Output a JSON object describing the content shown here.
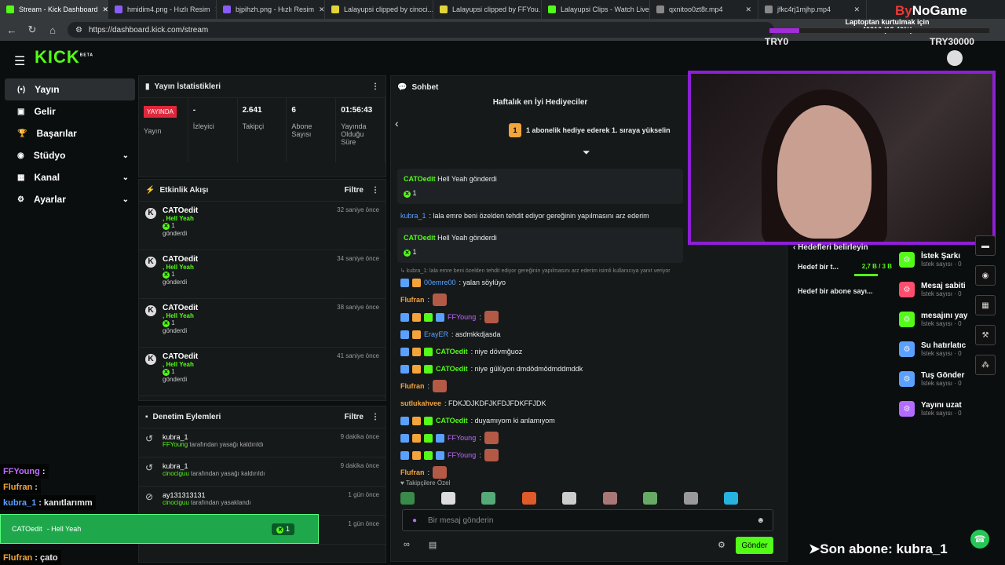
{
  "browser": {
    "tabs": [
      {
        "label": "Stream - Kick Dashboard",
        "color": "#53fc18"
      },
      {
        "label": "hmidim4.png - Hızlı Resim",
        "color": "#8a5cf6"
      },
      {
        "label": "bjpihzh.png - Hızlı Resim",
        "color": "#8a5cf6"
      },
      {
        "label": "Lalayupsi clipped by cinoci...",
        "color": "#e3d33a"
      },
      {
        "label": "Lalayupsi clipped by FFYou...",
        "color": "#e3d33a"
      },
      {
        "label": "Lalayupsi Clips - Watch Live...",
        "color": "#53fc18"
      },
      {
        "label": "qxnitoo0zt8r.mp4",
        "color": "#888888"
      },
      {
        "label": "jfkc4rj1mjhp.mp4",
        "color": "#888888"
      }
    ],
    "url": "https://dashboard.kick.com/stream"
  },
  "overlay": {
    "brand_a": "By",
    "brand_b": "NoGame",
    "goal_label": "Laptoptan kurtulmak için",
    "goal_value": "40216 (13.40%)",
    "goal_fraction": 0.134,
    "left_amount": "TRY0",
    "right_amount": "TRY30000",
    "son_abone": "➤Son abone: kubra_1"
  },
  "app": {
    "logo": "KICK",
    "logo_sup": "BETA"
  },
  "sidebar": {
    "items": [
      {
        "label": "Yayın",
        "icon": "(•)",
        "active": true,
        "chev": ""
      },
      {
        "label": "Gelir",
        "icon": "▣",
        "active": false,
        "chev": ""
      },
      {
        "label": "Başarılar",
        "icon": "🏆",
        "active": false,
        "chev": ""
      },
      {
        "label": "Stüdyo",
        "icon": "◉",
        "active": false,
        "chev": "⌄"
      },
      {
        "label": "Kanal",
        "icon": "▦",
        "active": false,
        "chev": "⌄"
      },
      {
        "label": "Ayarlar",
        "icon": "⚙",
        "active": false,
        "chev": "⌄"
      }
    ]
  },
  "stats": {
    "title": "Yayın İstatistikleri",
    "live": "YAYINDA",
    "items": [
      {
        "value": "",
        "label": "Yayın"
      },
      {
        "value": "-",
        "label": "İzleyici"
      },
      {
        "value": "2.641",
        "label": "Takipçi"
      },
      {
        "value": "6",
        "label": "Abone Sayısı"
      },
      {
        "value": "01:56:43",
        "label": "Yayında Olduğu Süre"
      }
    ]
  },
  "events": {
    "title": "Etkinlik Akışı",
    "filter": "Filtre",
    "items": [
      {
        "name": "CATOedit",
        "gift": ", Hell Yeah",
        "count": "1",
        "verb": "gönderdi",
        "time": "32 saniye önce"
      },
      {
        "name": "CATOedit",
        "gift": ", Hell Yeah",
        "count": "1",
        "verb": "gönderdi",
        "time": "34 saniye önce"
      },
      {
        "name": "CATOedit",
        "gift": ", Hell Yeah",
        "count": "1",
        "verb": "gönderdi",
        "time": "38 saniye önce"
      },
      {
        "name": "CATOedit",
        "gift": ", Hell Yeah",
        "count": "1",
        "verb": "gönderdi",
        "time": "41 saniye önce"
      }
    ]
  },
  "mod": {
    "title": "Denetim Eylemleri",
    "filter": "Filtre",
    "items": [
      {
        "name": "kubra_1",
        "by": "FFYoung",
        "action": "tarafından yasağı kaldırıldı",
        "time": "9 dakika önce"
      },
      {
        "name": "kubra_1",
        "by": "cinociguu",
        "action": "tarafından yasağı kaldırıldı",
        "time": "9 dakika önce"
      },
      {
        "name": "ay131313131",
        "by": "cinociguu",
        "action": "tarafından yasaklandı",
        "time": "1 gün önce"
      },
      {
        "name": "ay131313131",
        "by": "00emre00",
        "action": "tarafından yasaklandı",
        "time": "1 gün önce"
      }
    ]
  },
  "chat": {
    "title": "Sohbet",
    "gifters_title": "Haftalık en İyi Hediyeciler",
    "gifters_line": "1 abonelik hediye ederek 1. sıraya yükselin",
    "gifters_rank": "1",
    "cards": [
      {
        "user": "CATOedit",
        "text": "Hell Yeah gönderdi",
        "count": "1"
      },
      {
        "user": "CATOedit",
        "text": "Hell Yeah gönderdi",
        "count": "1"
      }
    ],
    "kubra_line": {
      "user": "kubra_1",
      "text": ": lala emre beni özelden tehdit ediyor gereğinin yapılmasını arz ederim"
    },
    "reply_ref": "kubra_1: lala emre beni özelden tehdit ediyor gereğinin yapılmasını arz ederim isimli kullanıcıya yanıt veriyor",
    "messages": [
      {
        "user": "00emre00",
        "text": ": yalan söylüyo",
        "cls": "u4",
        "badges": 2,
        "emote": false
      },
      {
        "user": "Flufran",
        "text": ":",
        "cls": "u3",
        "badges": 0,
        "emote": true
      },
      {
        "user": "FFYoung",
        "text": ":",
        "cls": "u5",
        "badges": 4,
        "emote": true
      },
      {
        "user": "ErayER",
        "text": ": asdmkkdjasda",
        "cls": "u4",
        "badges": 2,
        "emote": false
      },
      {
        "user": "CATOedit",
        "text": ": niye dövmğuoz",
        "cls": "u1",
        "badges": 3,
        "emote": false
      },
      {
        "user": "CATOedit",
        "text": ": niye gülüyon dmdödmödmddmddk",
        "cls": "u1",
        "badges": 3,
        "emote": false
      },
      {
        "user": "Flufran",
        "text": ":",
        "cls": "u3",
        "badges": 0,
        "emote": true
      },
      {
        "user": "sutlukahvee",
        "text": ": FDKJDJKDFJKFDJFDKFFJDK",
        "cls": "u3",
        "badges": 0,
        "emote": false
      },
      {
        "user": "CATOedit",
        "text": ": duyamıyom ki anlamıyom",
        "cls": "u1",
        "badges": 3,
        "emote": false
      },
      {
        "user": "FFYoung",
        "text": ":",
        "cls": "u5",
        "badges": 4,
        "emote": true
      },
      {
        "user": "FFYoung",
        "text": ":",
        "cls": "u5",
        "badges": 4,
        "emote": true
      },
      {
        "user": "Flufran",
        "text": ":",
        "cls": "u3",
        "badges": 0,
        "emote": true
      }
    ],
    "emote_label": "Takipçilere Özel",
    "placeholder": "Bir mesaj gönderin",
    "send": "Gönder"
  },
  "goals": {
    "title": "Hedefleri belirleyin",
    "items": [
      {
        "label": "Hedef bir t...",
        "value": "2,7 B / 3 B"
      },
      {
        "label": "Hedef bir abone sayı..."
      }
    ]
  },
  "actions": [
    {
      "title": "İstek Şarkı",
      "sub": "İstek sayısı · 0",
      "color": "#53fc18"
    },
    {
      "title": "Mesaj sabiti",
      "sub": "İstek sayısı · 0",
      "color": "#ff4d6d"
    },
    {
      "title": "mesajını yay",
      "sub": "İstek sayısı · 0",
      "color": "#53fc18"
    },
    {
      "title": "Su hatırlatıc",
      "sub": "İstek sayısı · 0",
      "color": "#5aa0ff"
    },
    {
      "title": "Tuş Gönder",
      "sub": "İstek sayısı · 0",
      "color": "#5aa0ff"
    },
    {
      "title": "Yayını uzat",
      "sub": "İstek sayısı · 0",
      "color": "#b46bff"
    }
  ],
  "overlay_chat": [
    {
      "user": "FFYoung",
      "text": ":",
      "cls": "u5"
    },
    {
      "user": "Flufran",
      "text": ":",
      "cls": "u3"
    },
    {
      "user": "kubra_1",
      "text": ": kanıtlarımm",
      "cls": "u4"
    },
    {
      "user": "Flufran",
      "text": ": çato",
      "cls": "u3"
    }
  ],
  "alert": {
    "user": "CATOedit",
    "text": "- Hell Yeah",
    "count": "1"
  }
}
